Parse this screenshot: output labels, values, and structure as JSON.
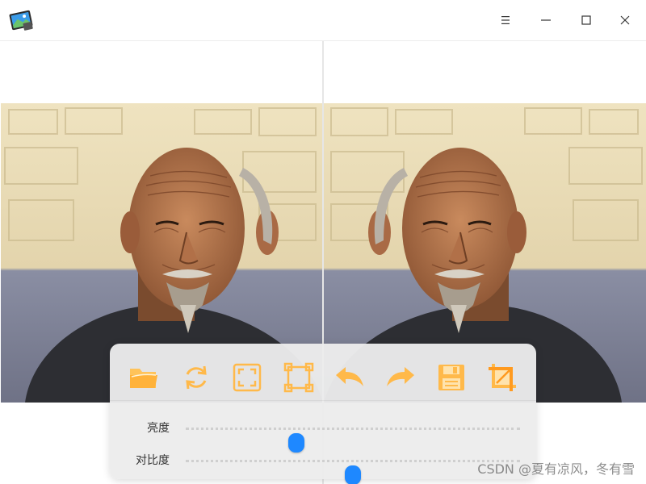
{
  "window": {
    "buttons": {
      "menu": "menu",
      "minimize": "minimize",
      "maximize": "maximize",
      "close": "close"
    }
  },
  "toolbar": {
    "accent_color": "#ffb94a",
    "icons": [
      "folder-open-icon",
      "rotate-icon",
      "fit-screen-icon",
      "actual-size-icon",
      "undo-icon",
      "redo-icon",
      "save-icon",
      "crop-icon"
    ]
  },
  "sliders": [
    {
      "label": "亮度",
      "value": 0.33
    },
    {
      "label": "对比度",
      "value": 0.5
    }
  ],
  "slider_accent": "#1e88ff",
  "watermark": "CSDN @夏有凉风，冬有雪"
}
